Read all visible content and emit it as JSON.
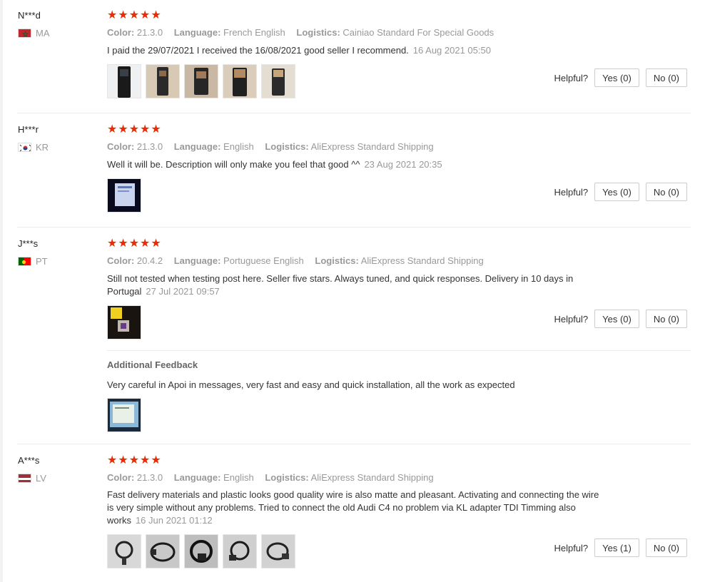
{
  "reviews": [
    {
      "user": "N***d",
      "country": "MA",
      "stars": "★★★★★",
      "color_label": "Color:",
      "color": "21.3.0",
      "language_label": "Language:",
      "language": "French English",
      "logistics_label": "Logistics:",
      "logistics": "Cainiao Standard For Special Goods",
      "text": "I paid the 29/07/2021 I received the 16/08/2021 good seller I recommend.",
      "date": "16 Aug 2021 05:50",
      "helpful_label": "Helpful?",
      "yes": "Yes (0)",
      "no": "No (0)"
    },
    {
      "user": "H***r",
      "country": "KR",
      "stars": "★★★★★",
      "color_label": "Color:",
      "color": "21.3.0",
      "language_label": "Language:",
      "language": "English",
      "logistics_label": "Logistics:",
      "logistics": "AliExpress Standard Shipping",
      "text": "Well it will be. Description will only make you feel that good ^^",
      "date": "23 Aug 2021 20:35",
      "helpful_label": "Helpful?",
      "yes": "Yes (0)",
      "no": "No (0)"
    },
    {
      "user": "J***s",
      "country": "PT",
      "stars": "★★★★★",
      "color_label": "Color:",
      "color": "20.4.2",
      "language_label": "Language:",
      "language": "Portuguese English",
      "logistics_label": "Logistics:",
      "logistics": "AliExpress Standard Shipping",
      "text": "Still not tested when testing post here. Seller five stars. Always tuned, and quick responses. Delivery in 10 days in Portugal",
      "date": "27 Jul 2021 09:57",
      "helpful_label": "Helpful?",
      "yes": "Yes (0)",
      "no": "No (0)",
      "additional_title": "Additional Feedback",
      "additional_text": "Very careful in Apoi in messages, very fast and easy and quick installation, all the work as expected"
    },
    {
      "user": "A***s",
      "country": "LV",
      "stars": "★★★★★",
      "color_label": "Color:",
      "color": "21.3.0",
      "language_label": "Language:",
      "language": "English",
      "logistics_label": "Logistics:",
      "logistics": "AliExpress Standard Shipping",
      "text": "Fast delivery materials and plastic looks good quality wire is also matte and pleasant. Activating and connecting the wire is very simple without any problems. Tried to connect the old Audi C4 no problem via KL adapter TDI Timming also works",
      "date": "16 Jun 2021 01:12",
      "helpful_label": "Helpful?",
      "yes": "Yes (1)",
      "no": "No (0)"
    }
  ],
  "colors": {
    "star": "#e62e04",
    "muted": "#999999",
    "separator": "#ececec"
  }
}
